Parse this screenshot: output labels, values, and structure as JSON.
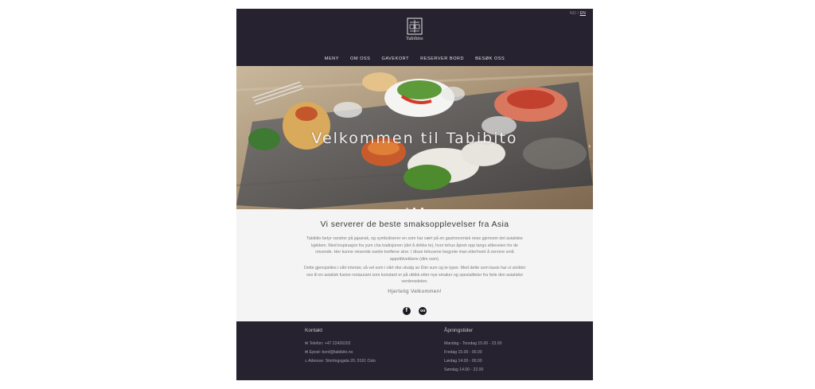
{
  "header": {
    "lang": {
      "no": "NO",
      "separator": "/",
      "en": "EN"
    },
    "logo_text": "Tabibito",
    "nav": [
      "MENY",
      "OM OSS",
      "GAVEKORT",
      "RESERVER BORD",
      "BESØK OSS"
    ]
  },
  "hero": {
    "title": "Velkommen til Tabibito",
    "slide_count": 3,
    "active_slide": 2
  },
  "intro": {
    "title": "Vi serverer de beste smaksopplevelser fra Asia",
    "paragraph1": "Tabibito betyr vandrer på japansk, og symboliserer en som har vært på en gastronomisk reise gjennom det asiatiske kjøkken. Med inspirasjon fra yum cha tradisjonen (det å drikke te), hvor tehus åpnet opp langs silkeveien for de reisende. Her kunne reisende samle kreftene sine. I disse tehusene begynte man etterhvert å servere små appetittvekkere (dim sum).",
    "paragraph2": "Dette gjenspeiles i vårt interiør, så vel som i vårt rike utvalg av Dim sum og te typer. Med dette som basis har vi utviklet oss til en asiatisk fusion restaurant som konstant er på utkikk etter nye smaker og spesialiteter fra hele den asiatiske verdensdelen.",
    "greeting": "Hjertelig Velkommen!"
  },
  "social": {
    "facebook": "f",
    "tripadvisor": "oo"
  },
  "footer": {
    "contact_title": "Kontakt",
    "contact": [
      "Telefon: +47 22426202",
      "Epost: bord@tabibito.no",
      "Adresse: Stortingsgata 20, 0161 Oslo"
    ],
    "hours_title": "Åpningstider",
    "hours": [
      "Mandag - Torsdag 15.00 - 23.00",
      "Fredag 15.00 - 00.00",
      "Lørdag 14.00 - 00.00",
      "Søndag 14.00 - 22.00"
    ]
  },
  "colors": {
    "header_bg": "#26222f",
    "body_bg": "#f4f4f4"
  }
}
